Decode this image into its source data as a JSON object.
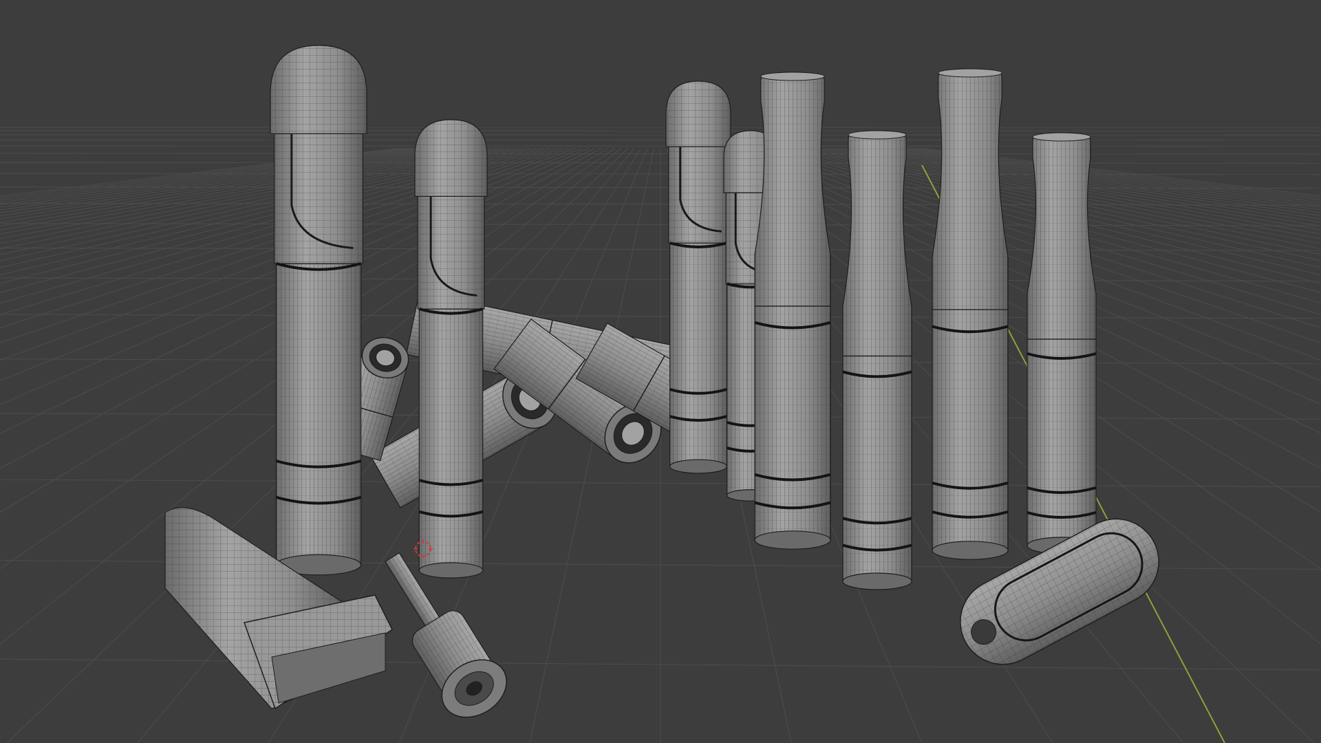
{
  "viewport": {
    "mode": "wireframe-overlay",
    "background": "#3d3d3d",
    "grid_color": "#4d4d4d",
    "axis_y_color": "#8aa33a",
    "mesh_fill": "#8c8c8c",
    "mesh_highlight": "#a2a2a2",
    "mesh_shadow": "#6a6a6a",
    "wire_color": "#1e1e1e",
    "cursor_color": "#d13b3b"
  },
  "objects": [
    {
      "kind": "cartridge-flat-tip",
      "count": 4
    },
    {
      "kind": "cartridge-drip-tip",
      "count": 4
    },
    {
      "kind": "battery-tube",
      "count": 5
    },
    {
      "kind": "usb-charger",
      "count": 1
    },
    {
      "kind": "threaded-connector",
      "count": 1
    },
    {
      "kind": "pod-capsule",
      "count": 1
    }
  ],
  "icons": {
    "cursor": "3d-cursor-icon"
  }
}
